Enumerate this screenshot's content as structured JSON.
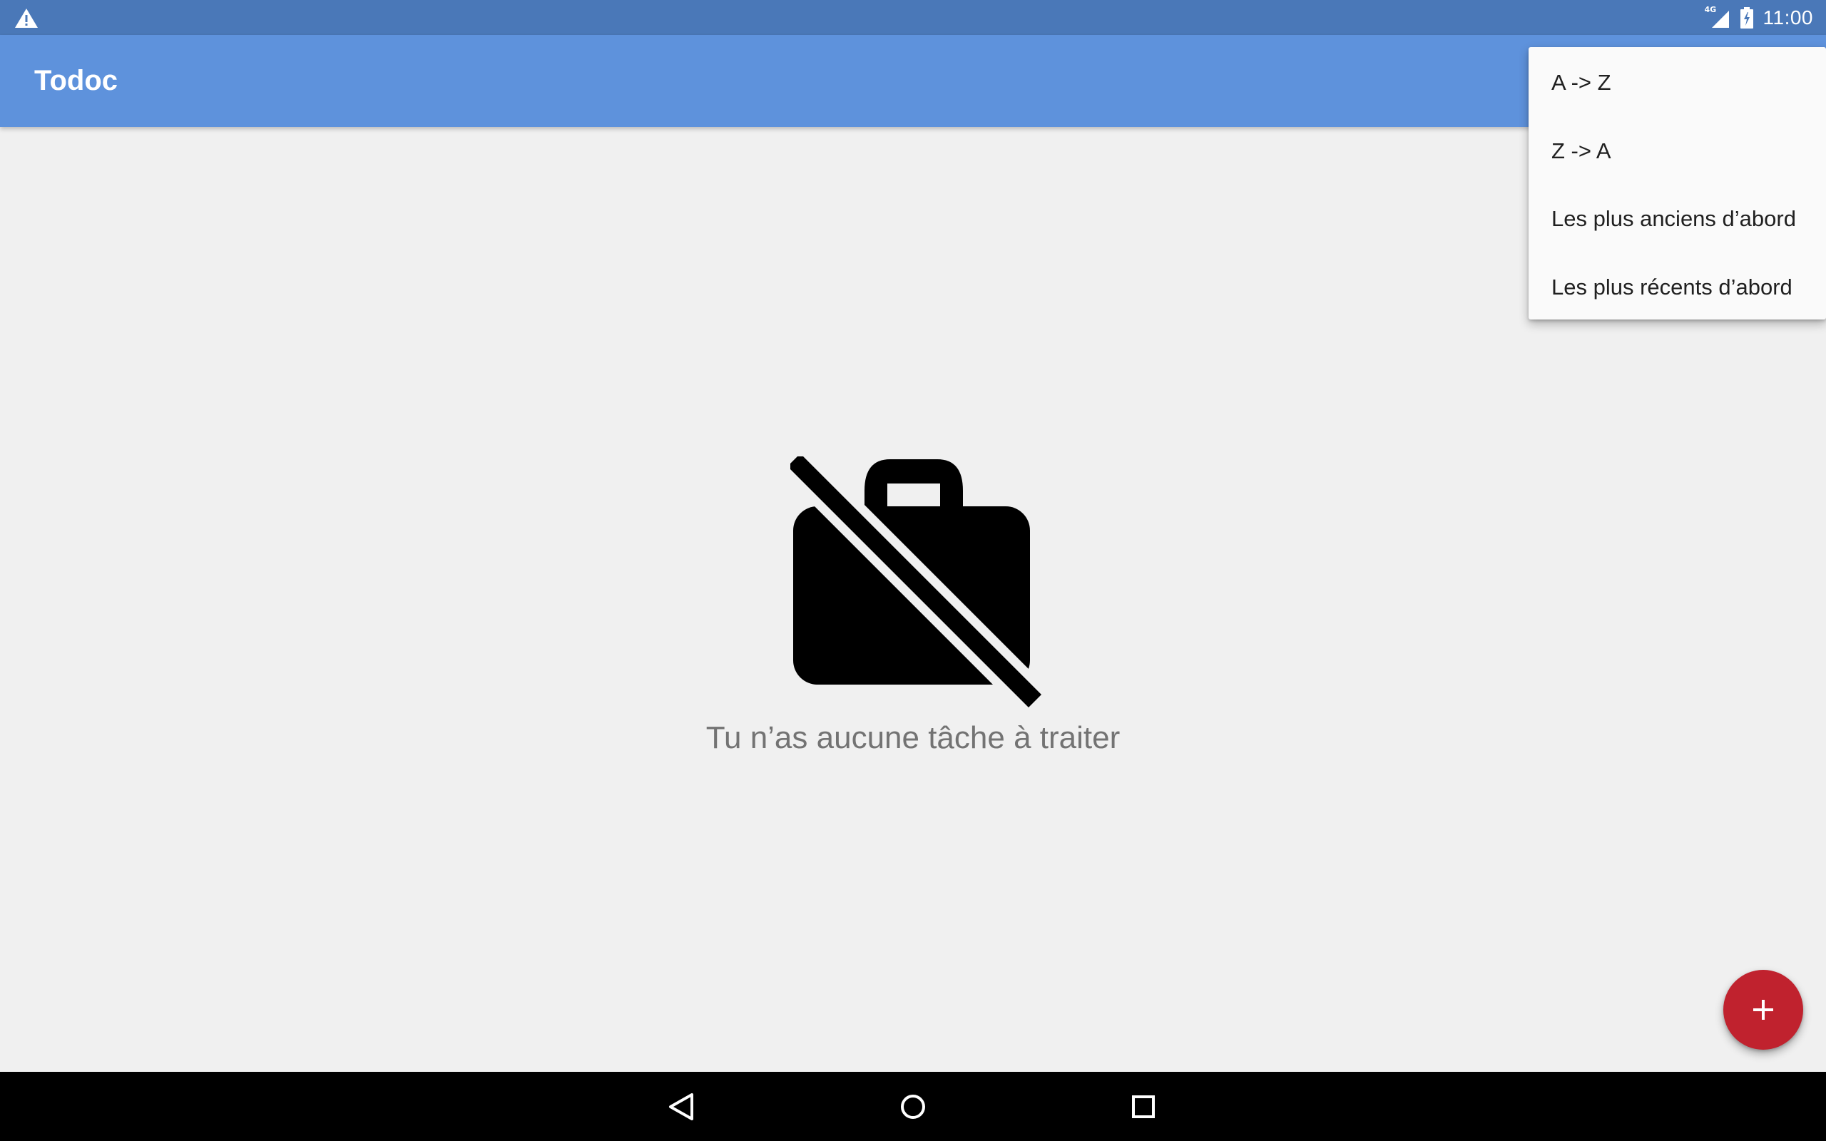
{
  "status_bar": {
    "time": "11:00",
    "network": "4G",
    "icons": [
      "warning-icon",
      "signal-icon",
      "battery-charging-icon"
    ]
  },
  "app_bar": {
    "title": "Todoc"
  },
  "sort_menu": {
    "items": [
      {
        "label": "A -> Z"
      },
      {
        "label": "Z -> A"
      },
      {
        "label": "Les plus anciens d’abord"
      },
      {
        "label": "Les plus récents d’abord"
      }
    ]
  },
  "empty_state": {
    "icon": "work-off-icon",
    "message": "Tu n’as aucune tâche à traiter"
  },
  "fab": {
    "icon": "add-icon",
    "color": "#c0222e"
  },
  "navigation": {
    "icons": [
      "back-icon",
      "home-icon",
      "recents-icon"
    ]
  },
  "colors": {
    "status_bar": "#4a78b8",
    "app_bar": "#5e92dc",
    "background": "#f0f0f0"
  }
}
